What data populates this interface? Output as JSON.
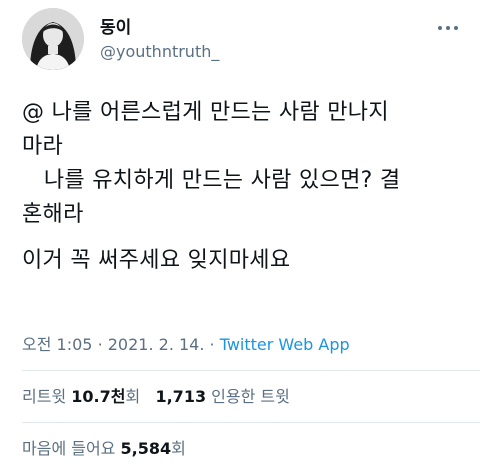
{
  "author": {
    "display_name": "동이",
    "handle": "@youthntruth_",
    "avatar_icon": "profile-photo",
    "more_icon": "more-dots-icon"
  },
  "tweet": {
    "lines": [
      "@ 나를 어른스럽게 만드는 사람 만나지",
      "마라",
      "   나를 유치하게 만드는 사람 있으면? 결",
      "혼해라"
    ],
    "closing": "이거 꼭 써주세요 잊지마세요"
  },
  "meta": {
    "time": "오전 1:05",
    "date": "2021. 2. 14.",
    "separator": "·",
    "app": "Twitter Web App"
  },
  "stats": {
    "retweets_label": "리트윗",
    "retweets_count": "10.7천",
    "retweets_unit": "회",
    "quotes_count": "1,713",
    "quotes_label": "인용한 트윗",
    "likes_label": "마음에 들어요",
    "likes_count": "5,584",
    "likes_unit": "회"
  },
  "colors": {
    "text": "#0f1419",
    "secondary": "#5b7083",
    "link": "#1b95e0",
    "divider": "#e1e8ed"
  }
}
